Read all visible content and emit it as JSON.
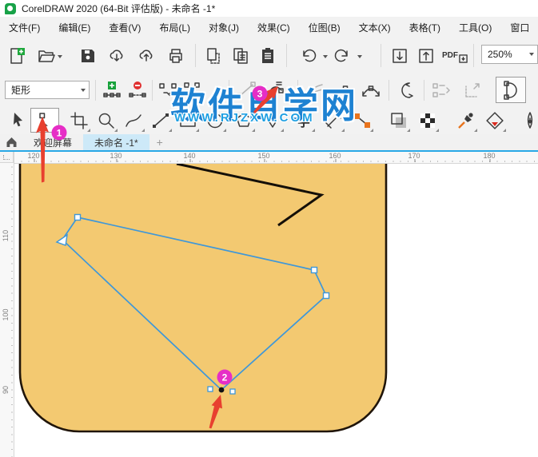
{
  "window": {
    "title": "CorelDRAW 2020 (64-Bit 评估版) - 未命名 -1*"
  },
  "menu": {
    "items": [
      "文件(F)",
      "编辑(E)",
      "查看(V)",
      "布局(L)",
      "对象(J)",
      "效果(C)",
      "位图(B)",
      "文本(X)",
      "表格(T)",
      "工具(O)",
      "窗口"
    ]
  },
  "toolbar": {
    "zoom_level": "250%",
    "pdf_label": "PDF"
  },
  "property_bar": {
    "shape_preset": "矩形"
  },
  "toolbox": {
    "text_tool_glyph": "字"
  },
  "watermark": {
    "site_name": "软件自学网",
    "site_url": "WWW.RJZXW.COM"
  },
  "document_tabs": {
    "tabs": [
      "欢迎屏幕",
      "未命名 -1*"
    ],
    "new_tab": "+"
  },
  "rulers": {
    "horizontal": [
      "120",
      "130",
      "140",
      "150",
      "160",
      "170",
      "180"
    ],
    "vertical": [
      "110",
      "100",
      "90"
    ]
  },
  "annotations": {
    "steps": [
      "1",
      "2",
      "3"
    ]
  },
  "colors": {
    "object_fill": "#f3c971",
    "object_outline": "#20150a",
    "selection_blue": "#3e97d9",
    "badge_magenta": "#e62ec6",
    "arrow_red": "#e8402f",
    "accent_line": "#29a8e6",
    "watermark_blue": "#1e82d2",
    "active_tab": "#cde9f8"
  }
}
